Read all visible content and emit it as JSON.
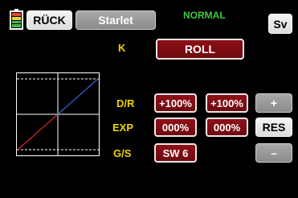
{
  "header": {
    "back_label": "RÜCK",
    "model_name": "Starlet",
    "flight_mode": "NORMAL",
    "save_label": "Sv"
  },
  "channel": {
    "label": "K",
    "value": "ROLL"
  },
  "rows": {
    "dr": {
      "label": "D/R",
      "value_left": "+100%",
      "value_right": "+100%"
    },
    "exp": {
      "label": "EXP",
      "value_left": "000%",
      "value_right": "000%"
    },
    "gs": {
      "label": "G/S",
      "value": "SW 6"
    }
  },
  "controls": {
    "plus_label": "+",
    "reset_label": "RES",
    "minus_label": "–"
  },
  "battery": {
    "segments": [
      "#d84a3a",
      "#e8d23a",
      "#47b54a",
      "#47b54a"
    ]
  },
  "colors": {
    "label_yellow": "#f0d400",
    "mode_green": "#3cc83c",
    "value_red": "#8f0f16",
    "curve_blue": "#2f66d8",
    "curve_red": "#d02828"
  }
}
